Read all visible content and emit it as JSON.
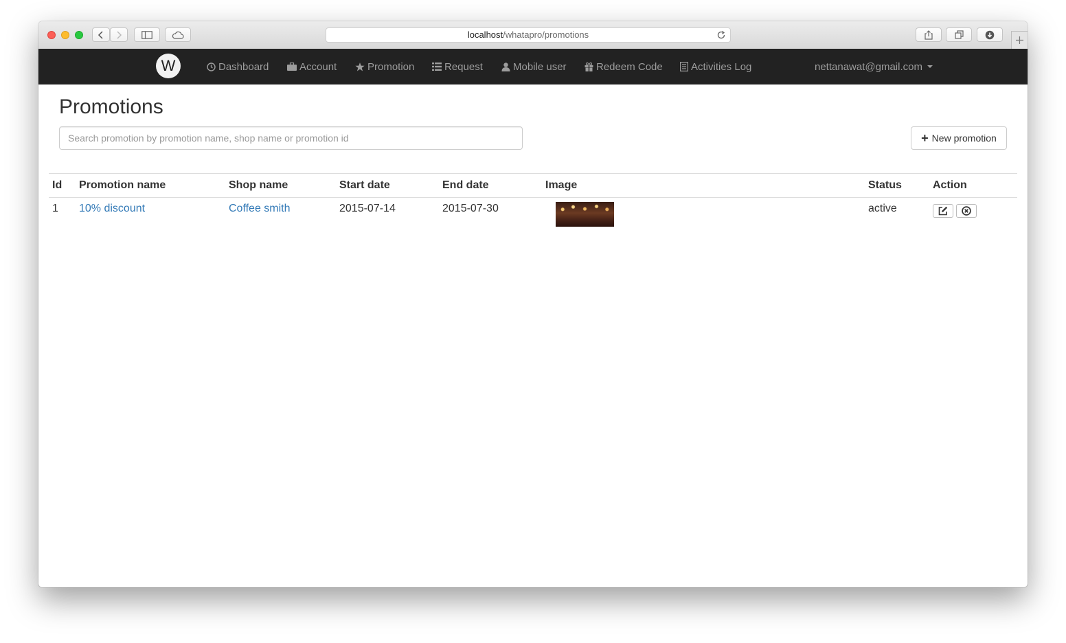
{
  "browser": {
    "url_host": "localhost",
    "url_path": "/whatapro/promotions"
  },
  "navbar": {
    "brand": "W",
    "items": [
      {
        "label": "Dashboard",
        "icon": "dashboard-icon"
      },
      {
        "label": "Account",
        "icon": "briefcase-icon"
      },
      {
        "label": "Promotion",
        "icon": "star-icon"
      },
      {
        "label": "Request",
        "icon": "list-icon"
      },
      {
        "label": "Mobile user",
        "icon": "user-icon"
      },
      {
        "label": "Redeem Code",
        "icon": "gift-icon"
      },
      {
        "label": "Activities Log",
        "icon": "log-icon"
      }
    ],
    "user_email": "nettanawat@gmail.com"
  },
  "page": {
    "title": "Promotions",
    "search_placeholder": "Search promotion by promotion name, shop name or promotion id",
    "new_button_label": "New promotion"
  },
  "table": {
    "headers": [
      "Id",
      "Promotion name",
      "Shop name",
      "Start date",
      "End date",
      "Image",
      "Status",
      "Action"
    ],
    "rows": [
      {
        "id": "1",
        "promotion_name": "10% discount",
        "shop_name": "Coffee smith",
        "start_date": "2015-07-14",
        "end_date": "2015-07-30",
        "status": "active"
      }
    ]
  },
  "colors": {
    "navbar_bg": "#222222",
    "nav_text": "#9d9d9d",
    "link": "#337ab7"
  }
}
